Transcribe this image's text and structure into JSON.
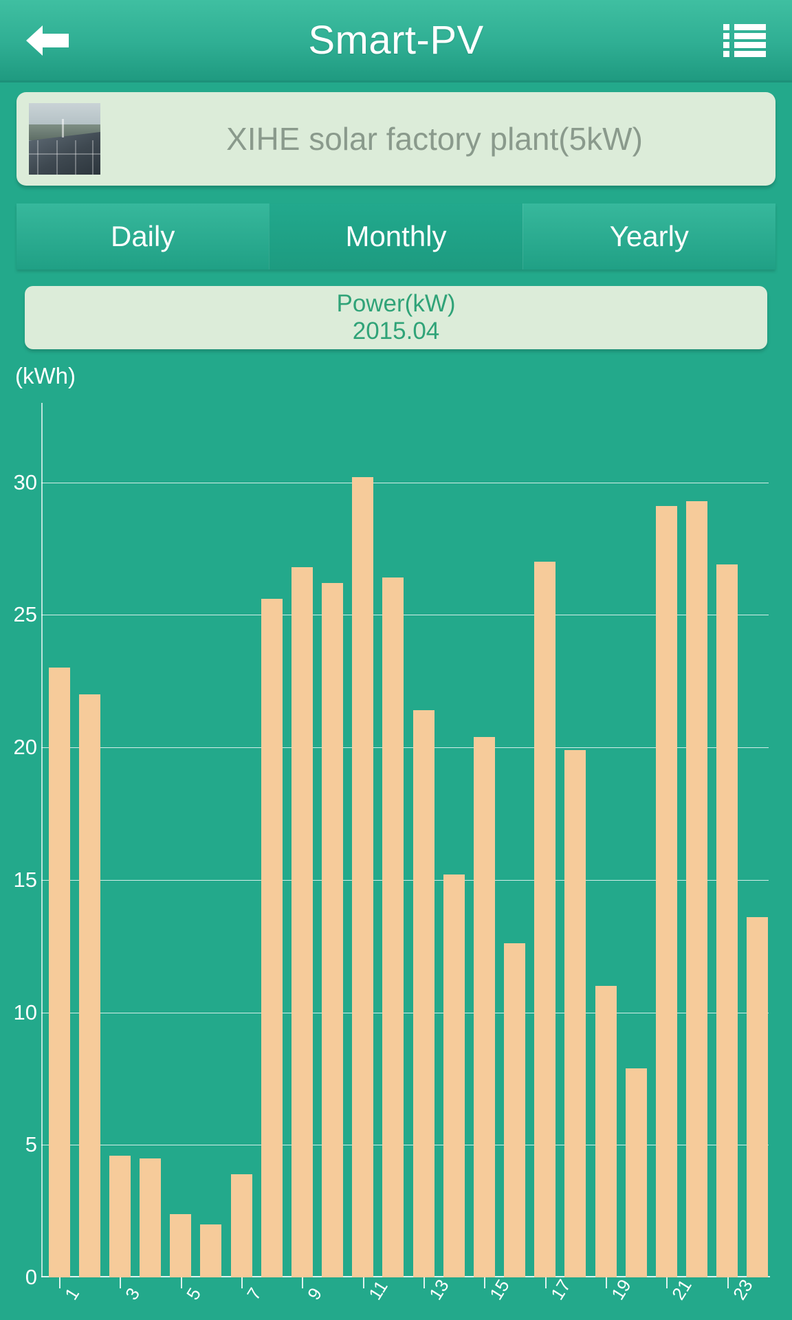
{
  "header": {
    "title": "Smart-PV",
    "back_icon": "arrow-left-icon",
    "menu_icon": "hamburger-list-icon"
  },
  "plant": {
    "name": "XIHE solar factory plant(5kW)",
    "thumbnail_alt": "solar-panel-photo"
  },
  "tabs": [
    {
      "label": "Daily",
      "active": false
    },
    {
      "label": "Monthly",
      "active": true
    },
    {
      "label": "Yearly",
      "active": false
    }
  ],
  "chart_panel": {
    "line1": "Power(kW)",
    "line2": "2015.04"
  },
  "colors": {
    "background": "#23a98b",
    "header": "#2fae93",
    "card": "#dcecd9",
    "bar": "#f6cb9a",
    "grid": "#ffffff",
    "title_text": "#30a378",
    "plant_text": "#8a9a8c"
  },
  "chart_data": {
    "type": "bar",
    "title": "Power(kW) 2015.04",
    "xlabel": "",
    "ylabel": "(kWh)",
    "ylim": [
      0,
      33
    ],
    "yticks": [
      0,
      5,
      10,
      15,
      20,
      25,
      30
    ],
    "ytick_labels": [
      "0",
      "5",
      "10",
      "15",
      "20",
      "25",
      "30"
    ],
    "xticks": [
      1,
      3,
      5,
      7,
      9,
      11,
      13,
      15,
      17,
      19,
      21,
      23
    ],
    "xtick_labels": [
      "1",
      "3",
      "5",
      "7",
      "9",
      "11",
      "13",
      "15",
      "17",
      "19",
      "21",
      "23"
    ],
    "grid": true,
    "legend": "none",
    "categories": [
      "1",
      "2",
      "3",
      "4",
      "5",
      "6",
      "7",
      "8",
      "9",
      "10",
      "11",
      "12",
      "13",
      "14",
      "15",
      "16",
      "17",
      "18",
      "19",
      "20",
      "21",
      "22",
      "23",
      "24"
    ],
    "values": [
      23.0,
      22.0,
      4.6,
      4.5,
      2.4,
      2.0,
      3.9,
      25.6,
      26.8,
      26.2,
      30.2,
      26.4,
      21.4,
      15.2,
      20.4,
      12.6,
      27.0,
      19.9,
      11.0,
      7.9,
      29.1,
      29.3,
      26.9,
      13.6
    ],
    "series_name": "Power(kWh)"
  }
}
